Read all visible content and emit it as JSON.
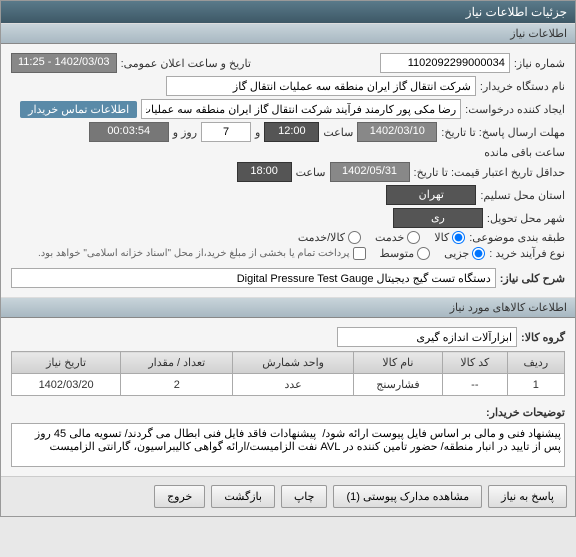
{
  "window": {
    "title": "جزئیات اطلاعات نیاز"
  },
  "sections": {
    "need_info": "اطلاعات نیاز",
    "goods_info": "اطلاعات کالاهای مورد نیاز"
  },
  "fields": {
    "need_no_label": "شماره نیاز:",
    "need_no": "1102092299000034",
    "announce_label": "تاریخ و ساعت اعلان عمومی:",
    "announce": "1402/03/03 - 11:25",
    "buyer_label": "نام دستگاه خریدار:",
    "buyer": "شرکت انتقال گاز ایران منطقه سه عملیات انتقال گاز",
    "creator_label": "ایجاد کننده درخواست:",
    "creator": "رضا مکی پور کارمند فرآیند شرکت انتقال گاز ایران منطقه سه عملیات انتقال گاز",
    "contact_badge": "اطلاعات تماس خریدار",
    "deadline_label": "مهلت ارسال پاسخ: تا تاریخ:",
    "deadline_date": "1402/03/10",
    "time_label": "ساعت",
    "deadline_time": "12:00",
    "and_label": "و",
    "day_label": "روز و",
    "days": "7",
    "remain_time": "00:03:54",
    "remain_label": "ساعت باقی مانده",
    "validity_label": "حداقل تاریخ اعتبار قیمت: تا تاریخ:",
    "validity_date": "1402/05/31",
    "validity_time": "18:00",
    "location_label": "استان محل تسلیم:",
    "location": "تهران",
    "city_label": "شهر محل تحویل:",
    "city": "ری",
    "category_label": "طبقه بندی موضوعی:",
    "cat_goods": "کالا",
    "cat_service": "خدمت",
    "cat_goods_service": "کالا/خدمت",
    "process_label": "نوع فرآیند خرید :",
    "proc_partial": "جزیی",
    "proc_medium": "متوسط",
    "proc_note": "پرداخت تمام یا بخشی از مبلغ خرید،از محل \"اسناد خزانه اسلامی\" خواهد بود.",
    "desc_label": "شرح کلی نیاز:",
    "desc": "دستگاه تست گیج دیجیتال Digital Pressure Test Gauge",
    "goods_group_label": "گروه کالا:",
    "goods_group": "ابزارآلات اندازه گیری",
    "buyer_notes_label": "توضیحات خریدار:",
    "buyer_notes": "پیشنهاد فنی و مالی بر اساس فایل پیوست ارائه شود/  پیشنهادات فاقد فایل فنی ابطال می گردند/ تسویه مالی 45 روز پس از تایید در انبار منطقه/ حضور تامین کننده در AVL نفت الزامیست/ارائه گواهی کالیبراسیون، گارانتی الزامیست"
  },
  "table": {
    "headers": {
      "row": "ردیف",
      "code": "کد کالا",
      "name": "نام کالا",
      "unit": "واحد شمارش",
      "qty": "تعداد / مقدار",
      "date": "تاریخ نیاز"
    },
    "rows": [
      {
        "row": "1",
        "code": "--",
        "name": "فشارسنج",
        "unit": "عدد",
        "qty": "2",
        "date": "1402/03/20"
      }
    ]
  },
  "footer": {
    "respond": "پاسخ به نیاز",
    "attachments": "مشاهده مدارک پیوستی (1)",
    "print": "چاپ",
    "back": "بازگشت",
    "exit": "خروج"
  }
}
